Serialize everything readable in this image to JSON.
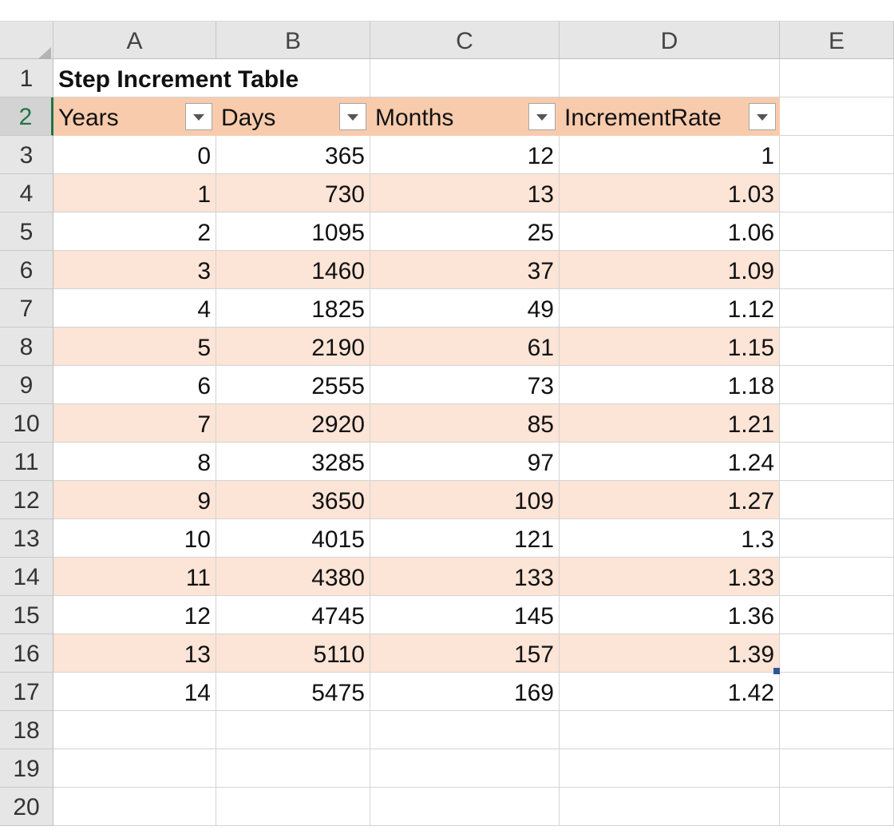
{
  "columns": [
    "A",
    "B",
    "C",
    "D",
    "E"
  ],
  "rows": [
    "1",
    "2",
    "3",
    "4",
    "5",
    "6",
    "7",
    "8",
    "9",
    "10",
    "11",
    "12",
    "13",
    "14",
    "15",
    "16",
    "17",
    "18",
    "19",
    "20"
  ],
  "title": "Step Increment Table",
  "table": {
    "headers": [
      "Years",
      "Days",
      "Months",
      "IncrementRate"
    ],
    "rows": [
      [
        "0",
        "365",
        "12",
        "1"
      ],
      [
        "1",
        "730",
        "13",
        "1.03"
      ],
      [
        "2",
        "1095",
        "25",
        "1.06"
      ],
      [
        "3",
        "1460",
        "37",
        "1.09"
      ],
      [
        "4",
        "1825",
        "49",
        "1.12"
      ],
      [
        "5",
        "2190",
        "61",
        "1.15"
      ],
      [
        "6",
        "2555",
        "73",
        "1.18"
      ],
      [
        "7",
        "2920",
        "85",
        "1.21"
      ],
      [
        "8",
        "3285",
        "97",
        "1.24"
      ],
      [
        "9",
        "3650",
        "109",
        "1.27"
      ],
      [
        "10",
        "4015",
        "121",
        "1.3"
      ],
      [
        "11",
        "4380",
        "133",
        "1.33"
      ],
      [
        "12",
        "4745",
        "145",
        "1.36"
      ],
      [
        "13",
        "5110",
        "157",
        "1.39"
      ],
      [
        "14",
        "5475",
        "169",
        "1.42"
      ]
    ]
  },
  "colors": {
    "header_fill": "#f8cbad",
    "band_fill": "#fce4d6",
    "grid": "#d4d4d4",
    "active_row": "#217346"
  }
}
